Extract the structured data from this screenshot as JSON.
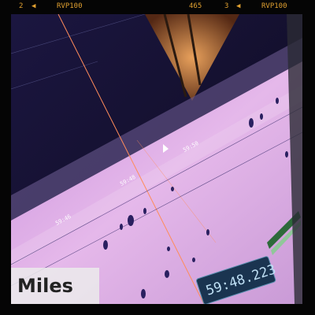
{
  "film": {
    "frame_a": "2",
    "label_a": "RVP100",
    "frame_num": "465",
    "frame_b": "3",
    "label_b": "RVP100",
    "arrow": "◀",
    "accent_color": "#e0a030"
  },
  "caption": {
    "text": "Miles"
  },
  "editor": {
    "timecode": "59:48.223",
    "ruler_labels": [
      "59:46",
      "59:48",
      "59:50"
    ],
    "waveform_color": "#2a2060",
    "track_color": "#d9a8e6",
    "playhead_color": "#ff8c5a"
  }
}
